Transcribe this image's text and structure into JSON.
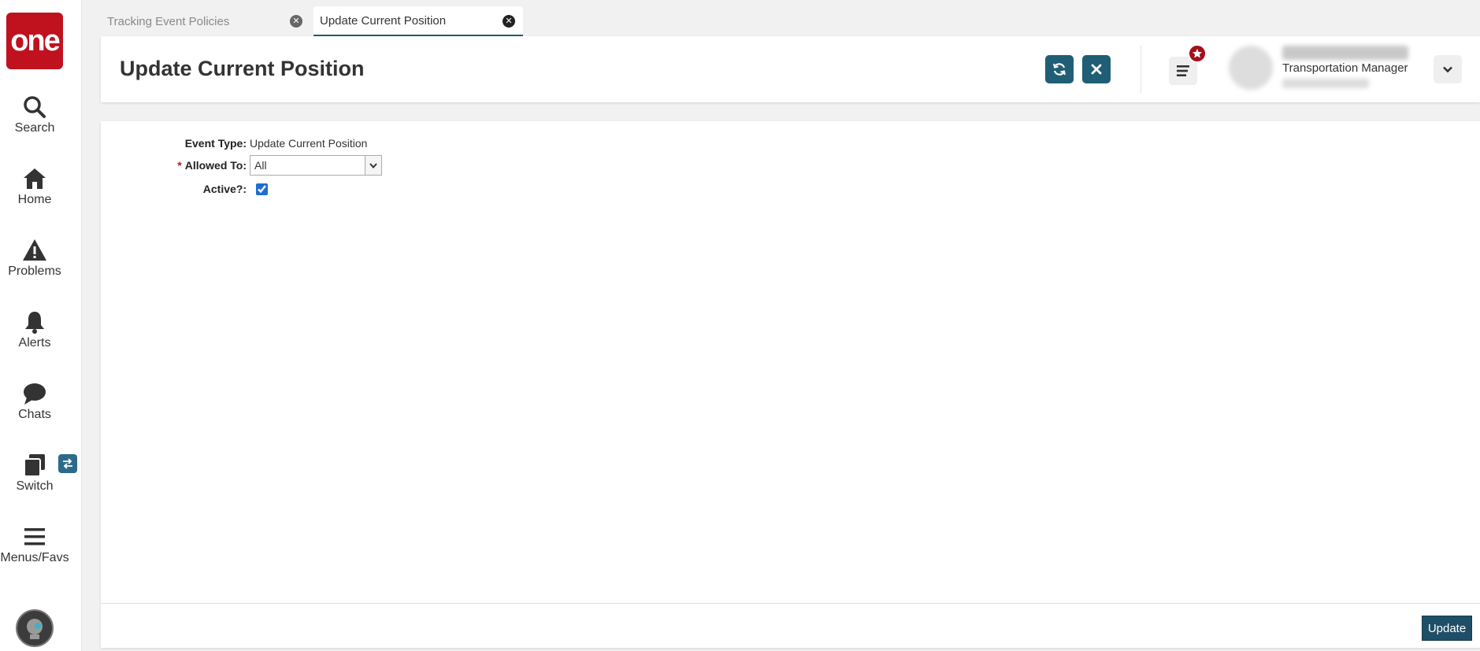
{
  "sidebar": {
    "logo_text": "one",
    "items": [
      {
        "label": "Search",
        "icon": "search-icon"
      },
      {
        "label": "Home",
        "icon": "home-icon"
      },
      {
        "label": "Problems",
        "icon": "warning-icon"
      },
      {
        "label": "Alerts",
        "icon": "bell-icon"
      },
      {
        "label": "Chats",
        "icon": "chat-icon"
      },
      {
        "label": "Switch",
        "icon": "windows-icon"
      },
      {
        "label": "Menus/Favs",
        "icon": "hamburger-icon"
      }
    ]
  },
  "tabs": [
    {
      "label": "Tracking Event Policies",
      "active": false
    },
    {
      "label": "Update Current Position",
      "active": true
    }
  ],
  "header": {
    "title": "Update Current Position",
    "user_role": "Transportation Manager"
  },
  "form": {
    "event_type_label": "Event Type:",
    "event_type_value": "Update Current Position",
    "allowed_to_required": "*",
    "allowed_to_label": "Allowed To:",
    "allowed_to_value": "All",
    "active_label": "Active?:",
    "active_checked": true
  },
  "footer": {
    "update_label": "Update"
  },
  "colors": {
    "brand_red": "#c0111f",
    "accent_teal": "#1f5e75",
    "update_button": "#1f4f68"
  }
}
